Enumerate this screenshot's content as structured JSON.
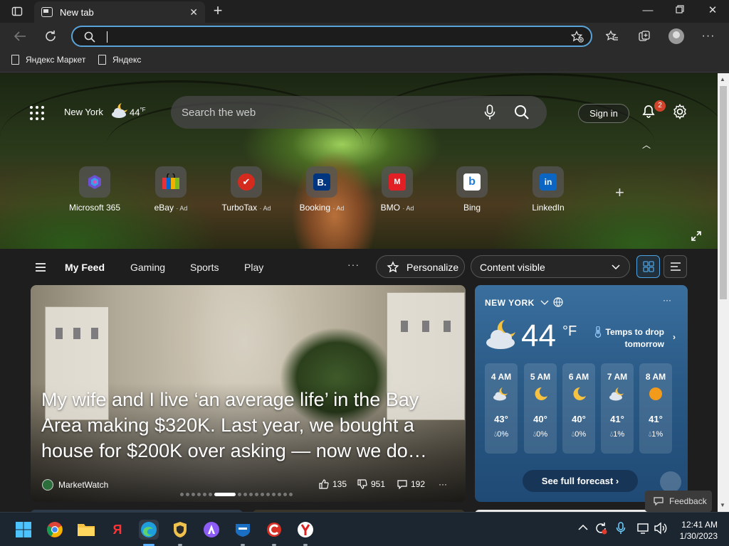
{
  "browser": {
    "tab_title": "New tab",
    "address_value": "",
    "favorites": [
      "Яндекс Маркет",
      "Яндекс"
    ]
  },
  "header": {
    "city": "New York",
    "temp": "44",
    "temp_unit": "°F",
    "search_placeholder": "Search the web",
    "signin_label": "Sign in",
    "notification_count": "2"
  },
  "quick_links": [
    {
      "label": "Microsoft 365",
      "ad": "",
      "color": "#7b5cd6",
      "glyph": ""
    },
    {
      "label": "eBay",
      "ad": "Ad",
      "color": "#e53238",
      "glyph": ""
    },
    {
      "label": "TurboTax",
      "ad": "Ad",
      "color": "#d52b1e",
      "glyph": "✔"
    },
    {
      "label": "Booking",
      "ad": "Ad",
      "color": "#003580",
      "glyph": "B."
    },
    {
      "label": "BMO",
      "ad": "Ad",
      "color": "#0079c1",
      "glyph": "M"
    },
    {
      "label": "Bing",
      "ad": "",
      "color": "#ffffff",
      "glyph": "b"
    },
    {
      "label": "LinkedIn",
      "ad": "",
      "color": "#0a66c2",
      "glyph": "in"
    }
  ],
  "feed_nav": {
    "items": [
      "My Feed",
      "Gaming",
      "Sports",
      "Play"
    ],
    "more": "···",
    "personalize_label": "Personalize",
    "content_visible_label": "Content visible"
  },
  "news": {
    "headline": "My wife and I live ‘an average life’ in the Bay Area making $320K. Last year, we bought a house for $200K over asking — now we do…",
    "source": "MarketWatch",
    "likes": "135",
    "dislikes": "951",
    "comments": "192",
    "more": "···"
  },
  "weather": {
    "city": "NEW YORK",
    "temp": "44",
    "unit": "°F",
    "alert": "Temps to drop tomorrow",
    "more": "···",
    "hours": [
      {
        "time": "4 AM",
        "temp": "43°",
        "precip": "0%",
        "icon": "cloud-moon"
      },
      {
        "time": "5 AM",
        "temp": "40°",
        "precip": "0%",
        "icon": "moon"
      },
      {
        "time": "6 AM",
        "temp": "40°",
        "precip": "0%",
        "icon": "moon"
      },
      {
        "time": "7 AM",
        "temp": "41°",
        "precip": "1%",
        "icon": "cloud-moon"
      },
      {
        "time": "8 AM",
        "temp": "41°",
        "precip": "1%",
        "icon": "sun"
      }
    ],
    "forecast_label": "See full forecast"
  },
  "feedback_label": "Feedback",
  "taskbar": {
    "time": "12:41 AM",
    "date": "1/30/2023"
  },
  "colors": {
    "accent": "#4ea2e0",
    "weather_bg": "#2a5a86",
    "badge": "#d2432c"
  }
}
